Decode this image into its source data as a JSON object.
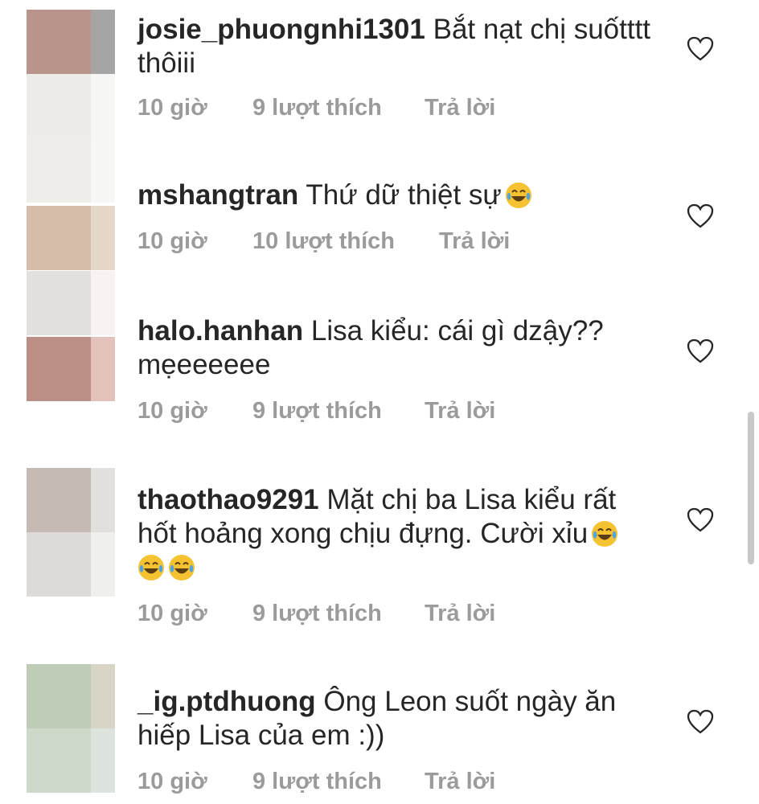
{
  "comments": [
    {
      "username": "josie_phuongnhi1301",
      "text": "Bắt nạt chị suốtttt thôiii",
      "time": "10 giờ",
      "likes": "9 lượt thích",
      "reply": "Trả lời",
      "emoji_count": 0
    },
    {
      "username": "mshangtran",
      "text": "Thứ dữ thiệt sự",
      "time": "10 giờ",
      "likes": "10 lượt thích",
      "reply": "Trả lời",
      "emoji_count": 1
    },
    {
      "username": "halo.hanhan",
      "text": "Lisa kiểu: cái gì dzậy?? mẹeeeeee",
      "time": "10 giờ",
      "likes": "9 lượt thích",
      "reply": "Trả lời",
      "emoji_count": 0
    },
    {
      "username": "thaothao9291",
      "text": "Mặt chị ba Lisa kiểu rất hốt hoảng xong chịu đựng. Cười xỉu",
      "time": "10 giờ",
      "likes": "9 lượt thích",
      "reply": "Trả lời",
      "emoji_count": 3
    },
    {
      "username": "_ig.ptdhuong",
      "text": "Ông Leon suốt ngày ăn hiếp Lisa của em :))",
      "time": "10 giờ",
      "likes": "9 lượt thích",
      "reply": "Trả lời",
      "emoji_count": 0
    }
  ],
  "icons": {
    "like": "heart-outline-icon",
    "emoji": "face-with-tears-of-joy-icon"
  },
  "colors": {
    "text": "#262626",
    "meta": "#9b9b9b",
    "emoji_face": "#f5c331",
    "emoji_tears": "#4fa3e0"
  }
}
